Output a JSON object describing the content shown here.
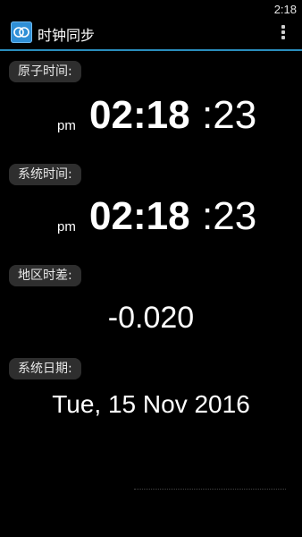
{
  "status_bar": {
    "time": "2:18"
  },
  "app": {
    "title": "时钟同步",
    "icon": "clock-sync-icon"
  },
  "sections": {
    "atomic_time": {
      "label": "原子时间:",
      "ampm": "pm",
      "hours_minutes": "02:18",
      "seconds": ":23"
    },
    "system_time": {
      "label": "系统时间:",
      "ampm": "pm",
      "hours_minutes": "02:18",
      "seconds": ":23"
    },
    "time_difference": {
      "label": "地区时差:",
      "value": "-0.020"
    },
    "system_date": {
      "label": "系统日期:",
      "value": "Tue, 15 Nov 2016"
    }
  },
  "colors": {
    "background": "#000000",
    "accent": "#2a8ebd",
    "label_pill": "#2e2e2e"
  }
}
